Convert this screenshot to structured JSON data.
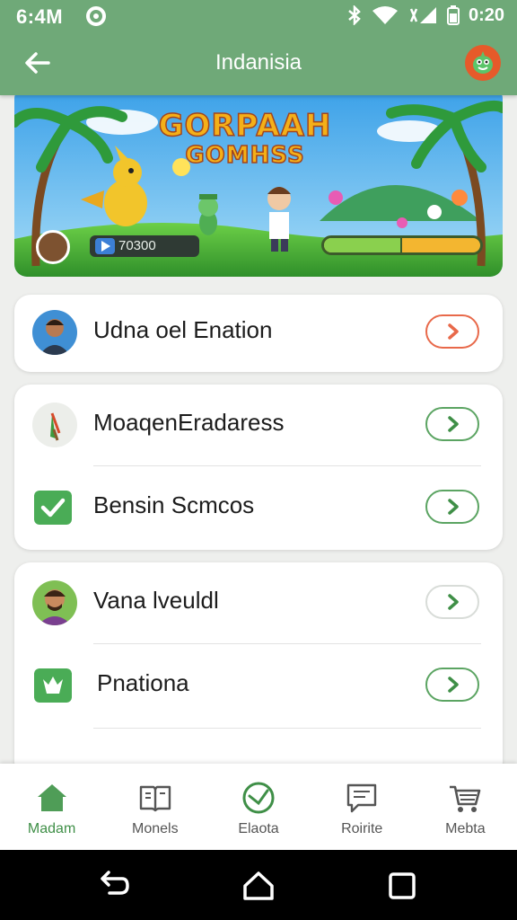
{
  "status_bar": {
    "time": "6:4M",
    "clock": "0:20"
  },
  "app_bar": {
    "title": "Indanisia"
  },
  "banner": {
    "title_line1": "GORPAAH",
    "title_line2": "GOMHSS",
    "score": "70300",
    "progress": 0.5
  },
  "cards": [
    {
      "rows": [
        {
          "label": "Udna oel Enation",
          "icon": "avatar-icon",
          "accent": "#e8694a"
        }
      ]
    },
    {
      "rows": [
        {
          "label": "MoaqenEradaress",
          "icon": "feather-pen-icon",
          "accent": "#5ba462"
        },
        {
          "label": "Bensin Scmcos",
          "icon": "checkbox-icon",
          "accent": "#5ba462"
        }
      ]
    },
    {
      "rows": [
        {
          "label": "Vana lveuldl",
          "icon": "avatar-icon",
          "accent": "#5ba462"
        },
        {
          "label": "Pnationa",
          "icon": "leaf-badge-icon",
          "accent": "#5ba462"
        }
      ]
    }
  ],
  "bottom_nav": [
    {
      "label": "Madam",
      "icon": "home-icon",
      "active": true
    },
    {
      "label": "Monels",
      "icon": "book-icon",
      "active": false
    },
    {
      "label": "Elaota",
      "icon": "gauge-icon",
      "active": false
    },
    {
      "label": "Roirite",
      "icon": "message-icon",
      "active": false
    },
    {
      "label": "Mebta",
      "icon": "cart-icon",
      "active": false
    }
  ],
  "colors": {
    "primary": "#6fa978",
    "accent_green": "#5ba462",
    "accent_orange": "#e8694a"
  }
}
